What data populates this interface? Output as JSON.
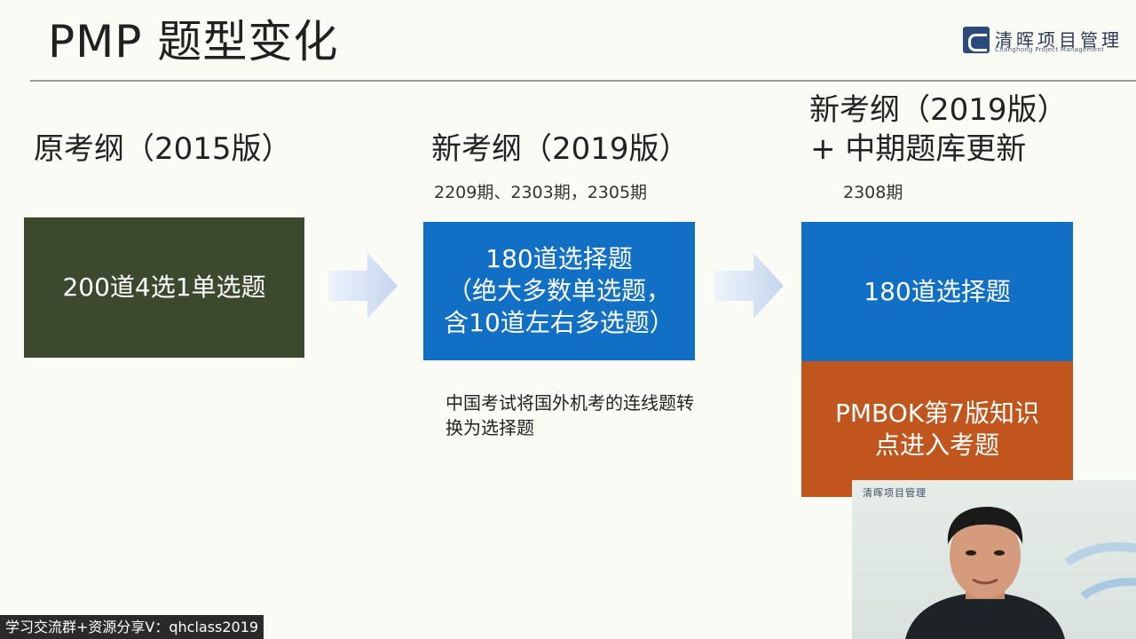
{
  "header": {
    "title": "PMP 题型变化",
    "logo_name": "清晖项目管理",
    "logo_english": "Changhong Project Management"
  },
  "columns": [
    {
      "heading": "原考纲（2015版）",
      "box_text": "200道4选1单选题",
      "box_color": "#3b4a2d"
    },
    {
      "heading": "新考纲（2019版）",
      "sub": "2209期、2303期，2305期",
      "box_lines": [
        "180道选择题",
        "（绝大多数单选题，",
        "含10道左右多选题）"
      ],
      "box_color": "#1170c4",
      "note": "中国考试将国外机考的连线题转换为选择题"
    },
    {
      "heading_line1": "新考纲（2019版）",
      "heading_line2": "+ 中期题库更新",
      "sub": "2308期",
      "box_top": "180道选择题",
      "box_top_color": "#1170c4",
      "box_bottom_lines": [
        "PMBOK第7版知识",
        "点进入考题"
      ],
      "box_bottom_color": "#c0561d"
    }
  ],
  "webcam": {
    "wall_logo": "清晖项目管理"
  },
  "watermark": "学习交流群+资源分享V：qhclass2019",
  "icons": {
    "arrows": [
      "right-arrow-icon",
      "right-arrow-icon"
    ],
    "logo": "qinghui-logo-icon"
  }
}
